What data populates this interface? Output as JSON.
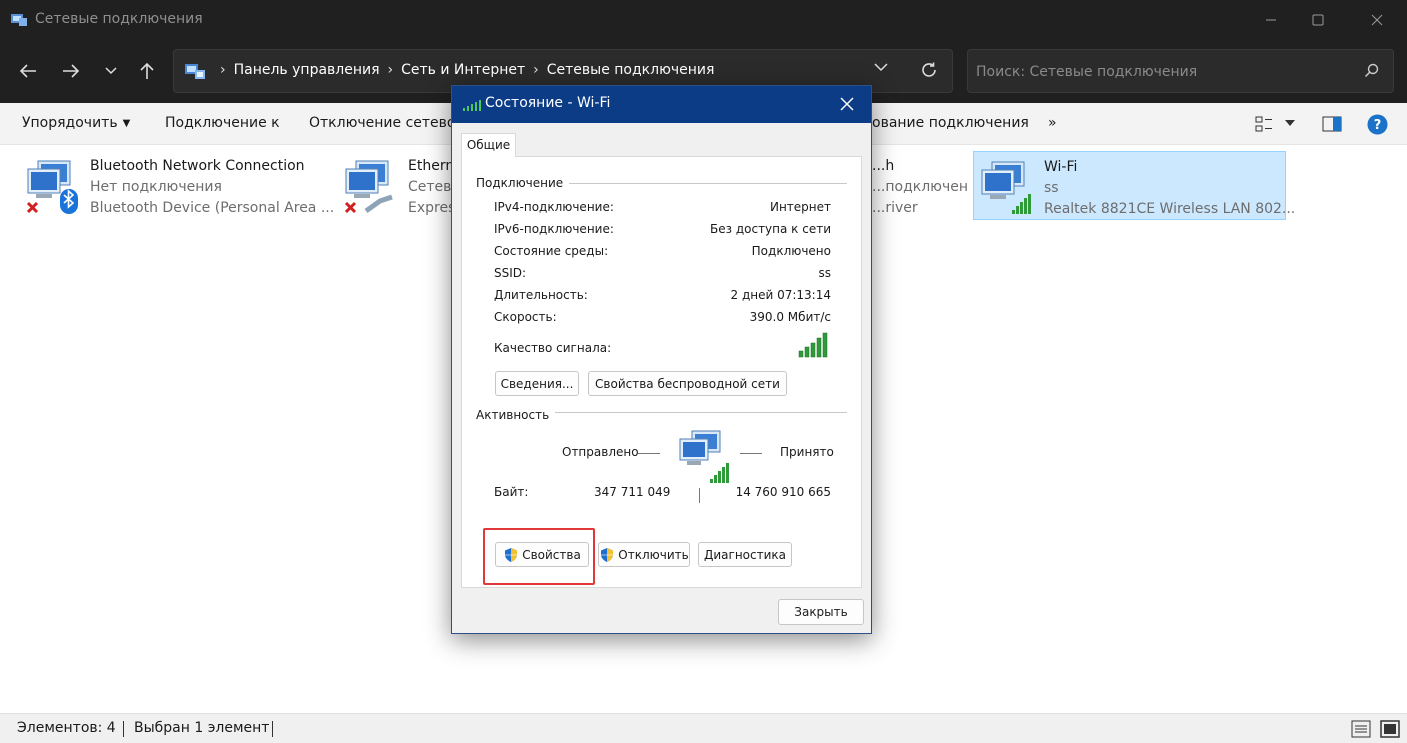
{
  "window": {
    "title": "Сетевые подключения"
  },
  "address": {
    "crumbs": [
      "Панель управления",
      "Сеть и Интернет",
      "Сетевые подключения"
    ],
    "search_placeholder": "Поиск: Сетевые подключения"
  },
  "toolbar": {
    "organize": "Упорядочить",
    "connect_to": "Подключение к",
    "disconnect": "Отключение сетевого устройства",
    "rename": "ование подключения",
    "more": "»"
  },
  "connections": [
    {
      "name": "Bluetooth Network Connection",
      "status": "Нет подключения",
      "device": "Bluetooth Device (Personal Area ..."
    },
    {
      "name": "Ethernet",
      "status": "Сетевой кабель не подключен",
      "device": "Express"
    },
    {
      "name": "...h",
      "status": "...подключен",
      "device": "...river"
    },
    {
      "name": "Wi-Fi",
      "status": "ss",
      "device": "Realtek 8821CE Wireless LAN 802..."
    }
  ],
  "statusbar": {
    "items": "Элементов: 4",
    "selected": "Выбран 1 элемент"
  },
  "dialog": {
    "title": "Состояние - Wi-Fi",
    "tab": "Общие",
    "connection_group": "Подключение",
    "rows": [
      {
        "label": "IPv4-подключение:",
        "value": "Интернет"
      },
      {
        "label": "IPv6-подключение:",
        "value": "Без доступа к сети"
      },
      {
        "label": "Состояние среды:",
        "value": "Подключено"
      },
      {
        "label": "SSID:",
        "value": "ss"
      },
      {
        "label": "Длительность:",
        "value": "2 дней 07:13:14"
      },
      {
        "label": "Скорость:",
        "value": "390.0 Мбит/с"
      }
    ],
    "signal_label": "Качество сигнала:",
    "signal_level": 5,
    "details_button": "Сведения...",
    "wireless_props_button": "Свойства беспроводной сети",
    "activity_group": "Активность",
    "sent_label": "Отправлено",
    "received_label": "Принято",
    "bytes_label": "Байт:",
    "bytes_sent": "347 711 049",
    "bytes_received": "14 760 910 665",
    "properties_button": "Свойства",
    "disable_button": "Отключить",
    "diagnose_button": "Диагностика",
    "close_button": "Закрыть"
  },
  "colors": {
    "dialog_title_bg": "#0c3c86",
    "selection_bg": "#cce8ff",
    "highlight_border": "#e0373a",
    "signal_green": "#2e9a3a"
  },
  "icons": [
    "back-arrow-icon",
    "forward-arrow-icon",
    "up-arrow-icon",
    "refresh-icon",
    "search-icon",
    "network-computer-icon",
    "bluetooth-icon",
    "ethernet-cable-icon",
    "wifi-signal-icon",
    "shield-icon",
    "help-icon",
    "close-icon"
  ]
}
